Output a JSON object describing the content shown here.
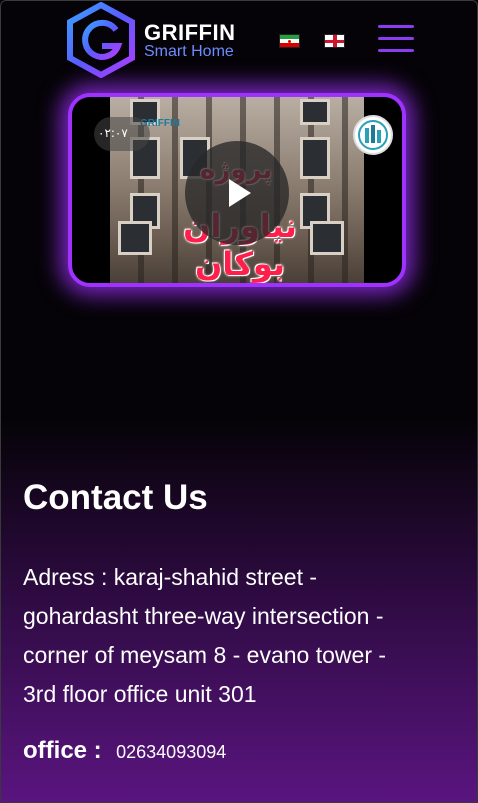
{
  "header": {
    "brand": "GRIFFIN",
    "tagline": "Smart Home",
    "logo_icon": "griffin-g-hexagon-logo",
    "languages": [
      {
        "name": "Persian",
        "icon": "iran-flag-icon"
      },
      {
        "name": "English",
        "icon": "england-flag-icon"
      }
    ],
    "menu_icon": "hamburger-menu-icon"
  },
  "video": {
    "duration": "۰۲:۰۷",
    "watermark": "GRIFFIN",
    "title_line_1": "پروژه",
    "title_line_2": "نیاوران بوکان",
    "play_icon": "play-icon",
    "channel_icon": "channel-logo-icon"
  },
  "contact": {
    "title": "Contact Us",
    "address_line_1": "Adress : karaj-shahid street -",
    "address_line_2": "gohardasht three-way intersection -",
    "address_line_3": "corner of meysam 8 - evano tower -",
    "address_line_4": "3rd floor office unit 301",
    "office_label": "office :",
    "office_number": "02634093094"
  },
  "colors": {
    "accent_purple": "#a032ff",
    "menu_purple": "#8b3bf0",
    "tagline_blue": "#6b8cff",
    "background_dark": "#050307",
    "background_bottom": "#5a1580"
  }
}
